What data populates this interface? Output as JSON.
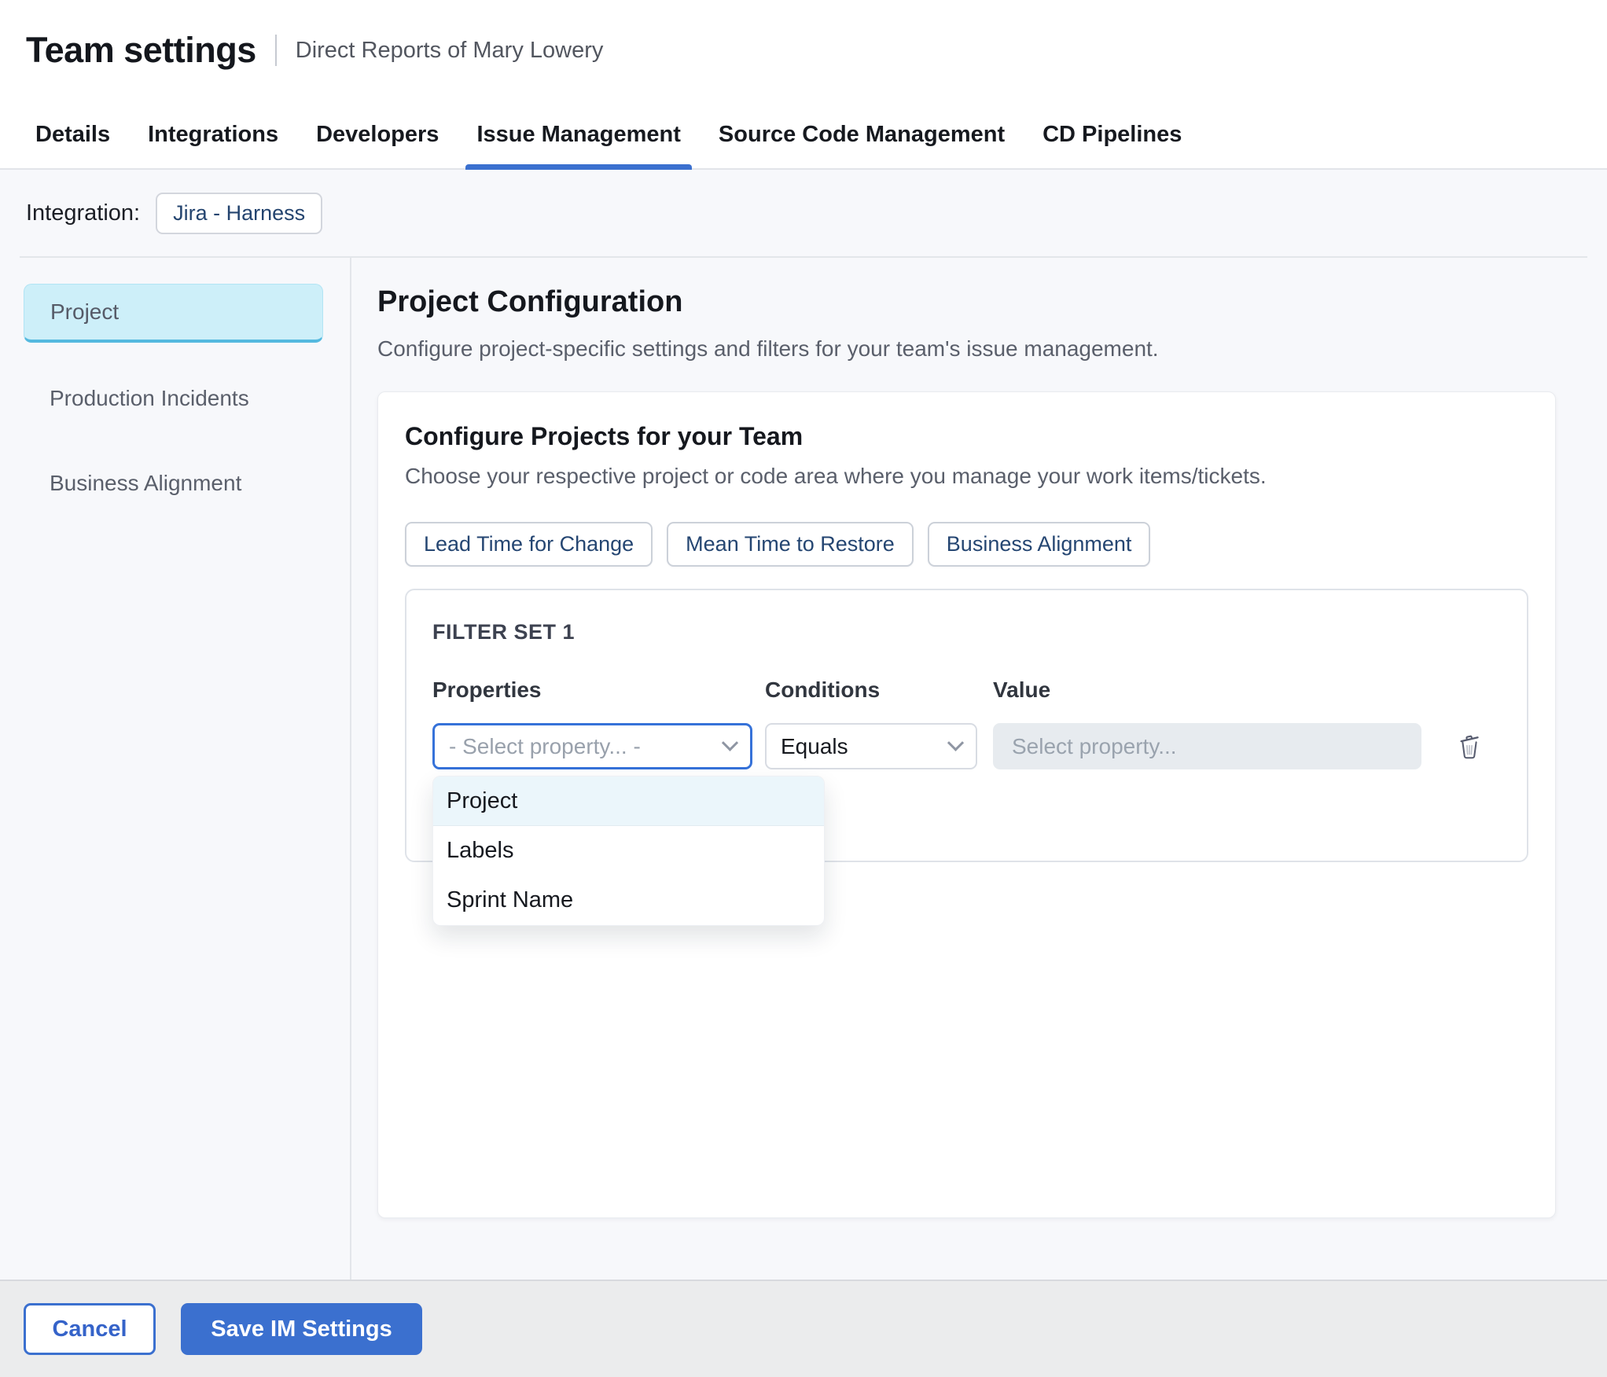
{
  "header": {
    "title": "Team settings",
    "subtitle": "Direct Reports of Mary Lowery"
  },
  "tabs": {
    "items": [
      {
        "label": "Details",
        "active": false
      },
      {
        "label": "Integrations",
        "active": false
      },
      {
        "label": "Developers",
        "active": false
      },
      {
        "label": "Issue Management",
        "active": true
      },
      {
        "label": "Source Code Management",
        "active": false
      },
      {
        "label": "CD Pipelines",
        "active": false
      }
    ]
  },
  "integration": {
    "label": "Integration:",
    "chip": "Jira - Harness"
  },
  "sidebar": {
    "items": [
      {
        "label": "Project",
        "selected": true
      },
      {
        "label": "Production Incidents",
        "selected": false
      },
      {
        "label": "Business Alignment",
        "selected": false
      }
    ]
  },
  "main": {
    "title": "Project Configuration",
    "description": "Configure project-specific settings and filters for your team's issue management.",
    "card": {
      "title": "Configure Projects for your Team",
      "description": "Choose your respective project or code area where you manage your work items/tickets.",
      "metric_tabs": [
        "Lead Time for Change",
        "Mean Time to Restore",
        "Business Alignment"
      ],
      "filter_set": {
        "title": "FILTER SET 1",
        "columns": [
          "Properties",
          "Conditions",
          "Value"
        ],
        "property_select": {
          "placeholder": "- Select property... -"
        },
        "condition_select": {
          "value": "Equals"
        },
        "value_input": {
          "placeholder": "Select property..."
        },
        "dropdown": {
          "options": [
            {
              "label": "Project",
              "highlighted": true
            },
            {
              "label": "Labels",
              "highlighted": false
            },
            {
              "label": "Sprint Name",
              "highlighted": false
            }
          ]
        }
      }
    }
  },
  "footer": {
    "cancel_label": "Cancel",
    "save_label": "Save IM Settings"
  },
  "colors": {
    "accent_blue": "#3b70cf",
    "selected_nav_bg": "#cdeff9",
    "selected_nav_underline": "#54b9df",
    "chip_text_navy": "#254672",
    "highlighted_option_bg": "#ebf6fb",
    "disabled_input_bg": "#e7ebef"
  }
}
